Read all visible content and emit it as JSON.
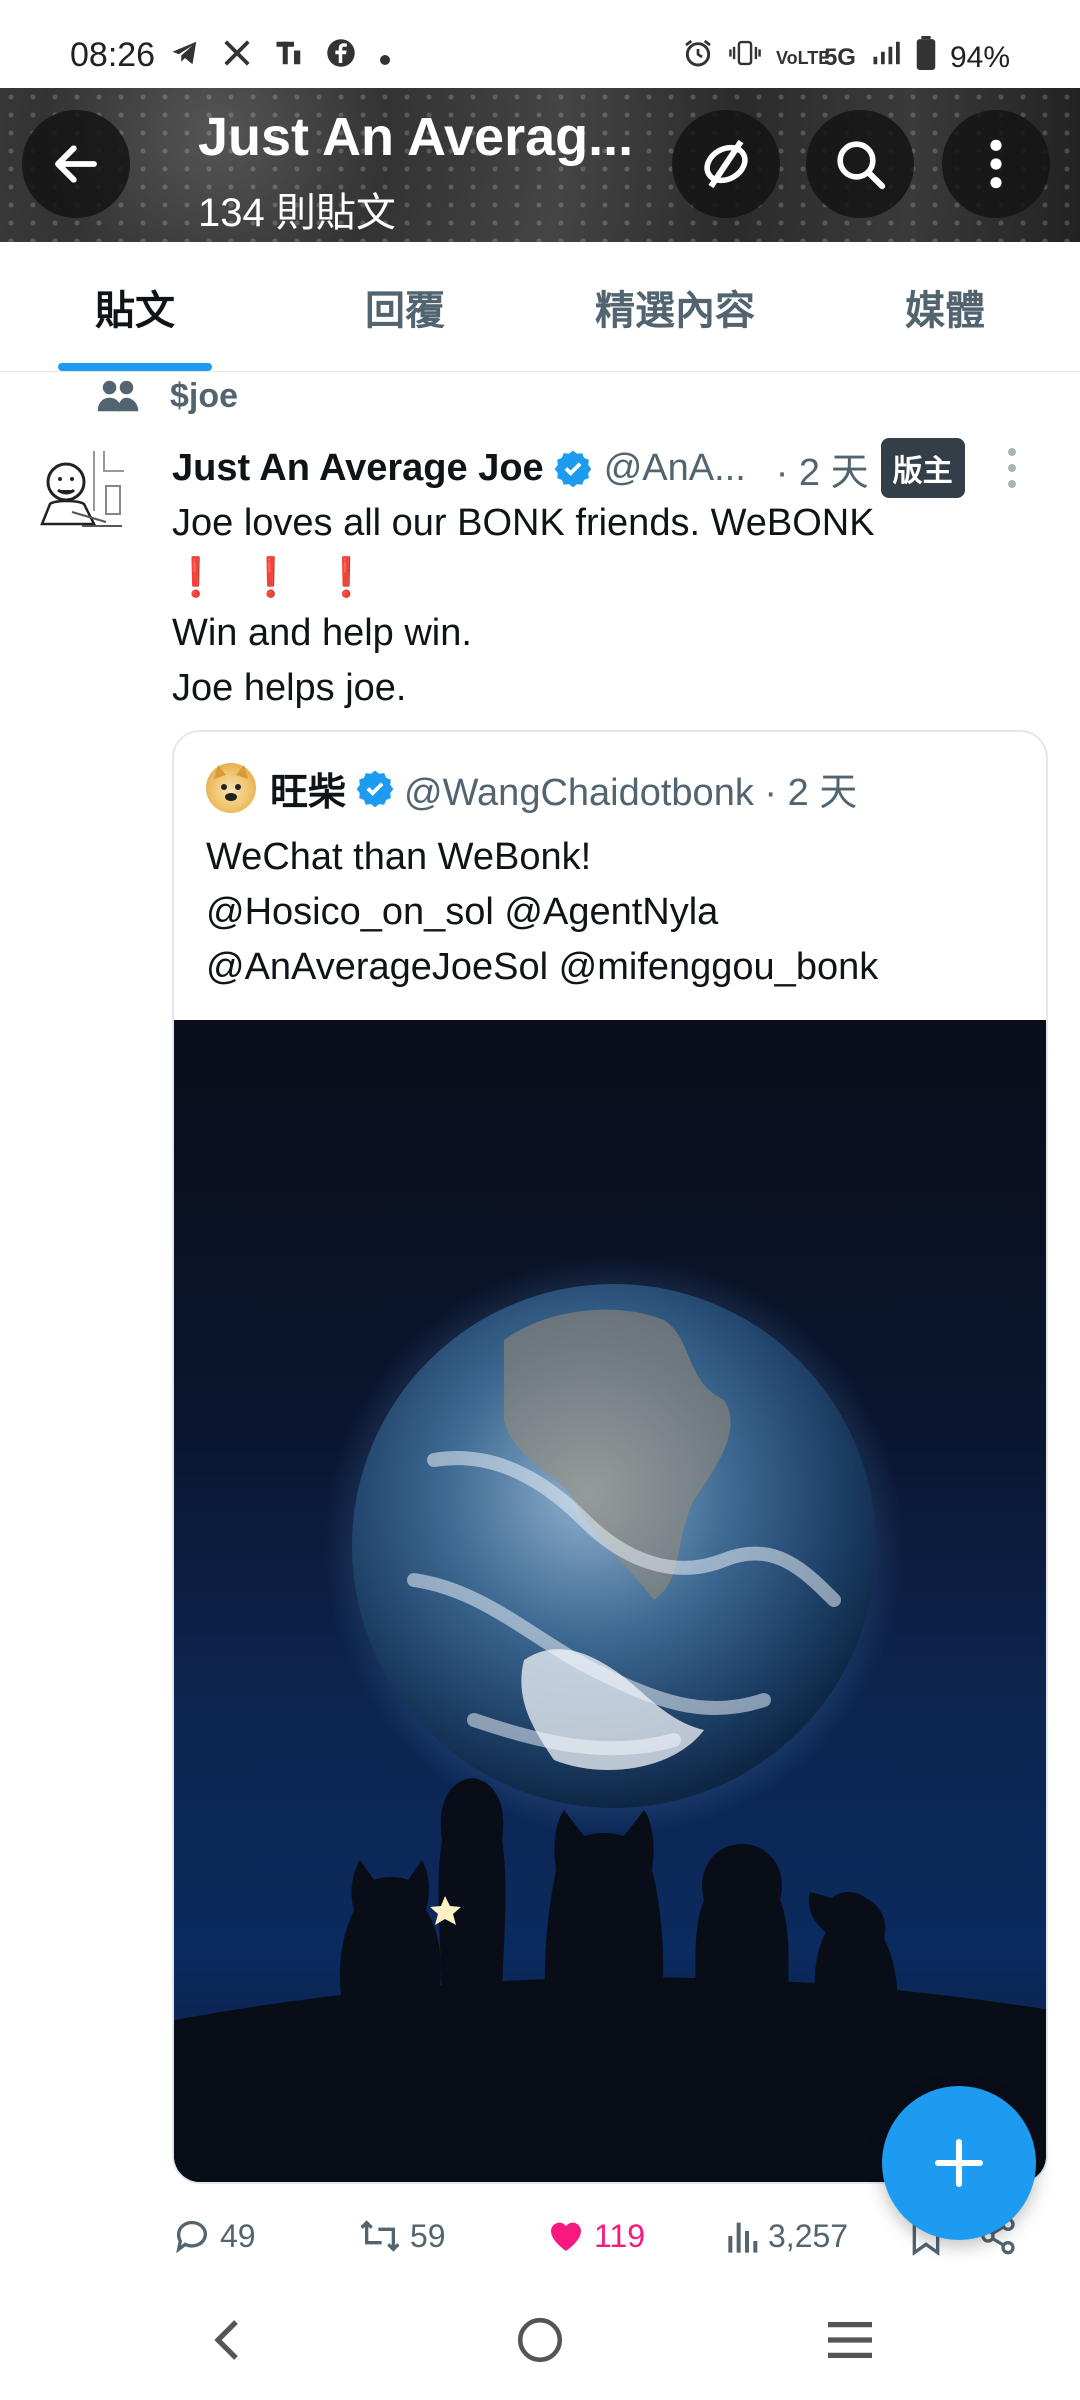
{
  "status_bar": {
    "time": "08:26",
    "icons_left": [
      "telegram-icon",
      "x-icon",
      "t-icon",
      "facebook-icon",
      "dot-icon"
    ],
    "icons_right": [
      "alarm-icon",
      "vibrate-icon",
      "volte-icon",
      "5g-icon",
      "signal-icon",
      "battery-icon"
    ],
    "network": "5G",
    "volte": "VoLTE",
    "battery": "94%"
  },
  "header": {
    "title": "Just An Averag...",
    "post_count": "134 則貼文"
  },
  "tabs": [
    {
      "label": "貼文",
      "active": true
    },
    {
      "label": "回覆",
      "active": false
    },
    {
      "label": "精選內容",
      "active": false
    },
    {
      "label": "媒體",
      "active": false
    }
  ],
  "community": {
    "label": "$joe"
  },
  "tweet": {
    "author": "Just An Average Joe",
    "handle": "@AnA...",
    "time": "· 2 天",
    "badge": "版主",
    "lines": [
      "Joe loves all our BONK friends. WeBONK",
      "❗❗❗",
      "Win and help win.",
      "Joe helps joe."
    ],
    "quote": {
      "author": "旺柴",
      "handle": "@WangChaidotbonk · 2 天",
      "lines": [
        "WeChat than WeBonk!",
        "@Hosico_on_sol @AgentNyla",
        "@AnAverageJoeSol @mifenggou_bonk"
      ]
    },
    "actions": {
      "replies": "49",
      "retweets": "59",
      "likes": "119",
      "views": "3,257"
    }
  },
  "colors": {
    "accent": "#1d9bf0",
    "like": "#f91880",
    "text": "#0f1419",
    "muted": "#536471"
  }
}
